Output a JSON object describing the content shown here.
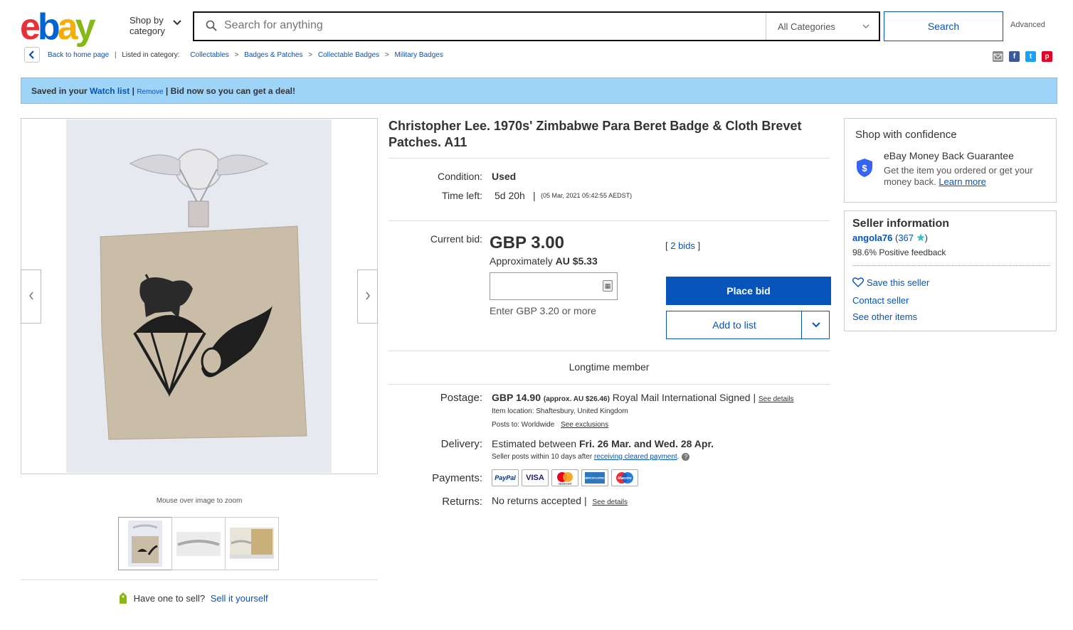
{
  "header": {
    "logo_letters": [
      "e",
      "b",
      "a",
      "y"
    ],
    "shop_by_line1": "Shop by",
    "shop_by_line2": "category",
    "search_placeholder": "Search for anything",
    "category_select": "All Categories",
    "search_button": "Search",
    "advanced_link": "Advanced"
  },
  "breadcrumb": {
    "back": "Back to home page",
    "listed_in": "Listed in category:",
    "items": [
      "Collectables",
      "Badges & Patches",
      "Collectable Badges",
      "Military Badges"
    ]
  },
  "share_icons": [
    "email-icon",
    "facebook-icon",
    "twitter-icon",
    "pinterest-icon"
  ],
  "banner": {
    "prefix": "Saved in your",
    "watchlist": "Watch list",
    "sep1": " | ",
    "remove": "Remove",
    "suffix": " | Bid now so you can get a deal!"
  },
  "gallery": {
    "zoom_hint": "Mouse over image to zoom",
    "thumbnails": 3
  },
  "sell": {
    "prompt": "Have one to sell?",
    "link": "Sell it yourself"
  },
  "item": {
    "title": "Christopher Lee. 1970s' Zimbabwe Para Beret Badge & Cloth Brevet Patches. A11",
    "condition_label": "Condition:",
    "condition": "Used",
    "time_left_label": "Time left:",
    "time_left": "5d 20h",
    "time_end": "(05 Mar, 2021   05:42:55 AEDST)",
    "current_bid_label": "Current bid:",
    "current_bid": "GBP 3.00",
    "approx": "Approximately",
    "approx_value": "AU $5.33",
    "bids_count": "2 bids",
    "bid_hint": "Enter GBP 3.20 or more",
    "place_bid": "Place bid",
    "add_to_list": "Add to list",
    "longtime": "Longtime member",
    "postage_label": "Postage:",
    "postage_price": "GBP 14.90",
    "postage_approx": "(approx. AU $26.46)",
    "postage_service": "Royal Mail International Signed |",
    "see_details": "See details",
    "item_location": "Item location:  Shaftesbury, United Kingdom",
    "posts_to_label": "Posts to:  Worldwide",
    "see_exclusions": "See exclusions",
    "delivery_label": "Delivery:",
    "delivery_prefix": "Estimated between",
    "delivery_dates": "Fri. 26 Mar. and Wed. 28 Apr.",
    "seller_posts": "Seller posts within 10 days after",
    "receiving_payment": "receiving cleared payment",
    "payments_label": "Payments:",
    "payment_methods": [
      "PayPal",
      "VISA",
      "mastercard",
      "AMERICAN EXPRESS",
      "Maestro"
    ],
    "returns_label": "Returns:",
    "returns": "No returns accepted |",
    "returns_details": "See details"
  },
  "confidence": {
    "title": "Shop with confidence",
    "guarantee_title": "eBay Money Back Guarantee",
    "guarantee_text": "Get the item you ordered or get your money back.",
    "learn_more": "Learn more"
  },
  "seller": {
    "title": "Seller information",
    "name": "angola76",
    "score_open": "(",
    "score": "367",
    "score_close": ")",
    "feedback": "98.6% Positive feedback",
    "save_seller": "Save this seller",
    "contact": "Contact seller",
    "other_items": "See other items"
  },
  "colors": {
    "link": "#0654ba",
    "banner_bg": "#9fd4f9",
    "button_blue": "#0654ba"
  }
}
